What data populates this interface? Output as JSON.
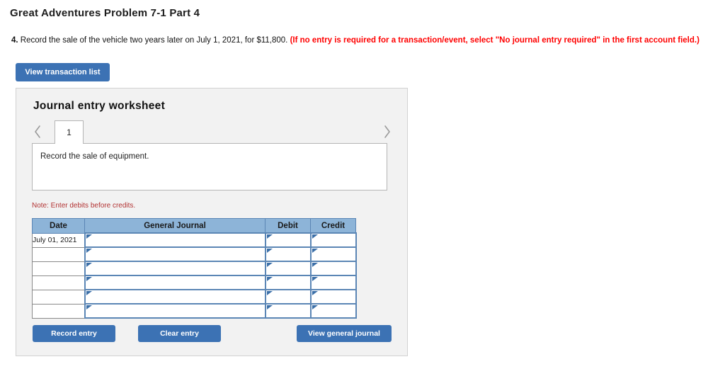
{
  "page": {
    "title": "Great Adventures Problem 7-1 Part 4"
  },
  "question": {
    "number": "4.",
    "text": " Record the sale of the vehicle two years later on July 1, 2021, for $11,800. ",
    "hint": "(If no entry is required for a transaction/event, select \"No journal entry required\" in the first account field.)"
  },
  "toolbar": {
    "view_transaction_list_label": "View transaction list"
  },
  "worksheet": {
    "title": "Journal entry worksheet",
    "tabs": [
      {
        "label": "1",
        "active": true
      }
    ],
    "nav": {
      "prev_icon": "chevron-left-icon",
      "next_icon": "chevron-right-icon"
    },
    "description": "Record the sale of equipment.",
    "note": "Note: Enter debits before credits."
  },
  "table": {
    "headers": [
      "Date",
      "General Journal",
      "Debit",
      "Credit"
    ],
    "rows": [
      {
        "date": "July 01, 2021",
        "general_journal": "",
        "debit": "",
        "credit": ""
      },
      {
        "date": "",
        "general_journal": "",
        "debit": "",
        "credit": ""
      },
      {
        "date": "",
        "general_journal": "",
        "debit": "",
        "credit": ""
      },
      {
        "date": "",
        "general_journal": "",
        "debit": "",
        "credit": ""
      },
      {
        "date": "",
        "general_journal": "",
        "debit": "",
        "credit": ""
      },
      {
        "date": "",
        "general_journal": "",
        "debit": "",
        "credit": ""
      }
    ]
  },
  "actions": {
    "record_entry_label": "Record entry",
    "clear_entry_label": "Clear entry",
    "view_general_journal_label": "View general journal"
  },
  "colors": {
    "button_blue": "#3c72b4",
    "table_header_blue": "#8db4d8",
    "input_border_blue": "#5b86b5",
    "hint_red": "#ff0000",
    "note_red": "#b23232",
    "panel_gray": "#f2f2f2"
  }
}
